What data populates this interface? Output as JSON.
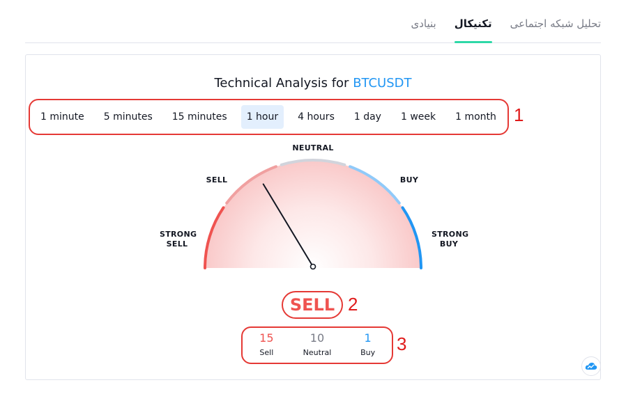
{
  "tabs": [
    {
      "label": "تحلیل شبکه اجتماعی",
      "active": false
    },
    {
      "label": "تکنیکال",
      "active": true
    },
    {
      "label": "بنیادی",
      "active": false
    }
  ],
  "title": {
    "prefix": "Technical Analysis for",
    "symbol": "BTCUSDT"
  },
  "intervals": [
    {
      "label": "1 minute",
      "active": false
    },
    {
      "label": "5 minutes",
      "active": false
    },
    {
      "label": "15 minutes",
      "active": false
    },
    {
      "label": "1 hour",
      "active": true
    },
    {
      "label": "4 hours",
      "active": false
    },
    {
      "label": "1 day",
      "active": false
    },
    {
      "label": "1 week",
      "active": false
    },
    {
      "label": "1 month",
      "active": false
    }
  ],
  "gauge": {
    "labels": {
      "strong_sell": "STRONG\nSELL",
      "sell": "SELL",
      "neutral": "NEUTRAL",
      "buy": "BUY",
      "strong_buy": "STRONG\nBUY"
    },
    "needle_fraction": 0.33,
    "colors": {
      "strong_sell": "#ef5350",
      "sell": "#f0a0a0",
      "neutral": "#d1d4dc",
      "buy": "#90caf9",
      "strong_buy": "#2196f3"
    }
  },
  "signal": "SELL",
  "counts": [
    {
      "key": "sell",
      "value": "15",
      "label": "Sell"
    },
    {
      "key": "neutral",
      "value": "10",
      "label": "Neutral"
    },
    {
      "key": "buy",
      "value": "1",
      "label": "Buy"
    }
  ],
  "annotations": [
    "1",
    "2",
    "3"
  ],
  "accent_color": "#2ed8a7"
}
